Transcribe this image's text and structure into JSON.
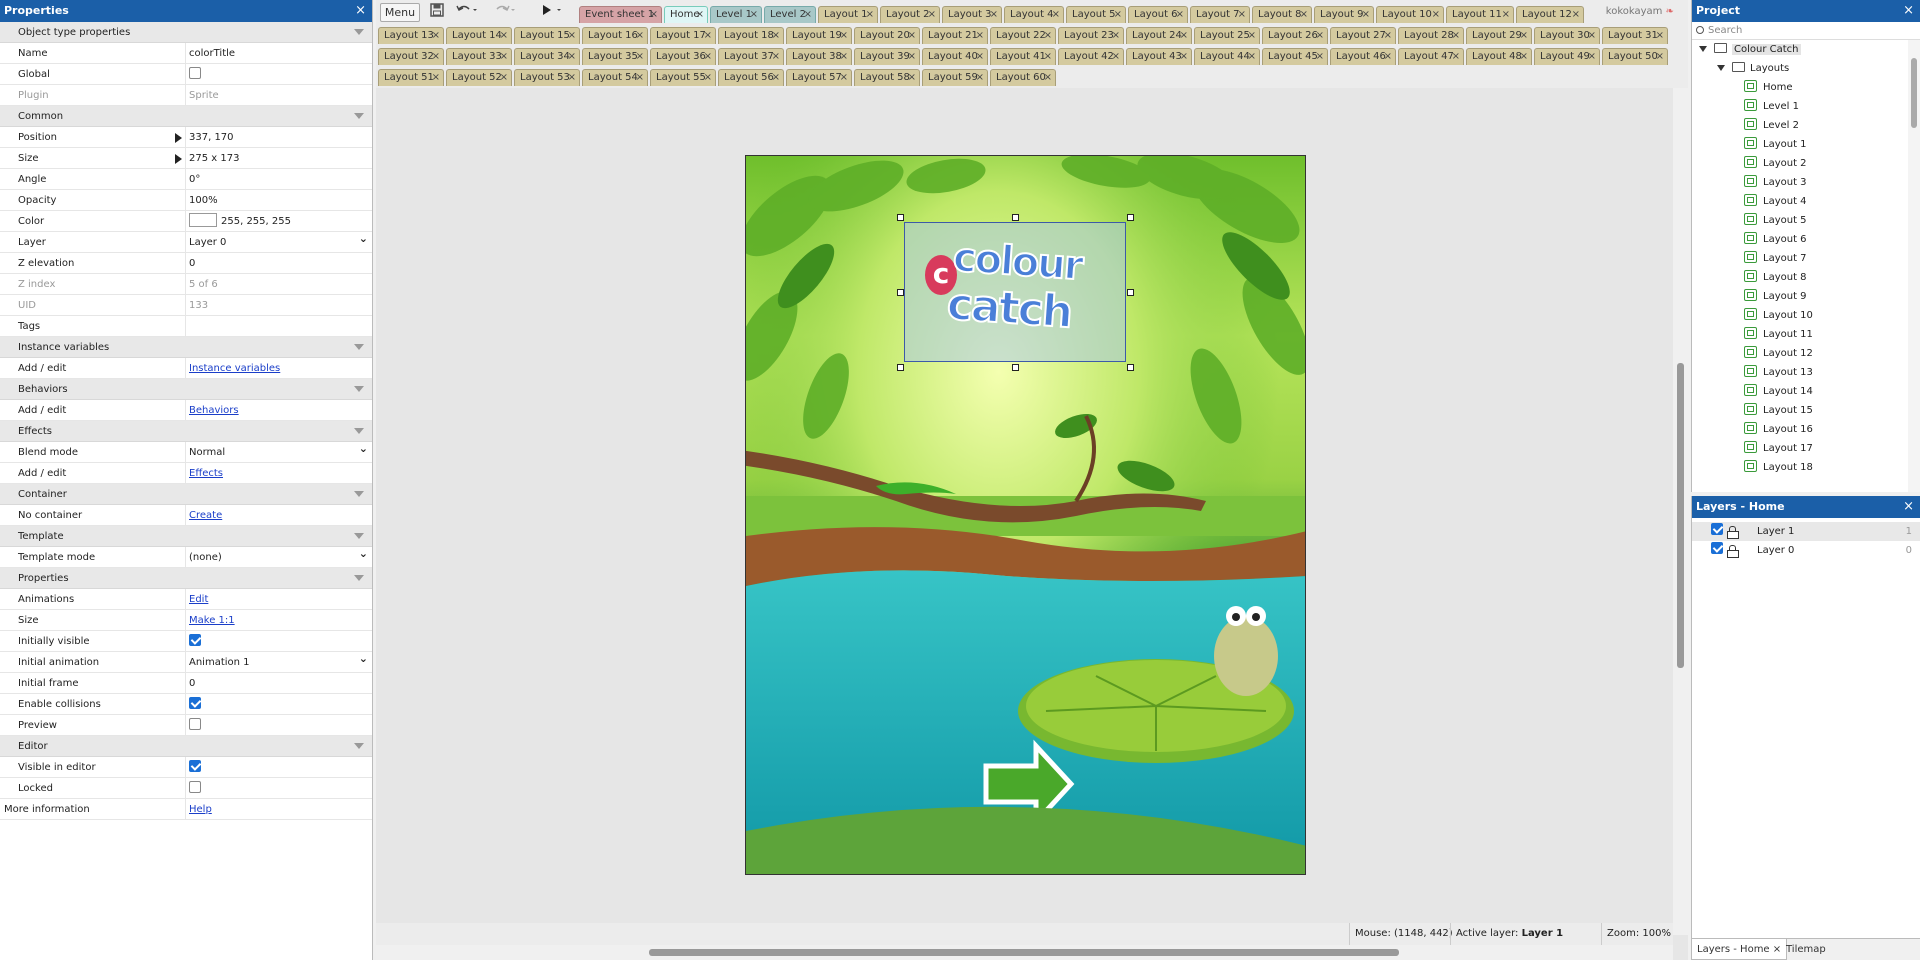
{
  "properties": {
    "title": "Properties",
    "close": "×",
    "rows": [
      {
        "type": "section",
        "name": "Object type properties"
      },
      {
        "type": "text",
        "name": "Name",
        "value": "colorTitle"
      },
      {
        "type": "check",
        "name": "Global",
        "checked": false
      },
      {
        "type": "text",
        "name": "Plugin",
        "value": "Sprite",
        "gray": true
      },
      {
        "type": "section",
        "name": "Common"
      },
      {
        "type": "text",
        "name": "Position",
        "value": "337, 170",
        "expand": true
      },
      {
        "type": "text",
        "name": "Size",
        "value": "275 x 173",
        "expand": true
      },
      {
        "type": "text",
        "name": "Angle",
        "value": "0°"
      },
      {
        "type": "text",
        "name": "Opacity",
        "value": "100%"
      },
      {
        "type": "color",
        "name": "Color",
        "value": "255, 255, 255"
      },
      {
        "type": "select",
        "name": "Layer",
        "value": "Layer 0"
      },
      {
        "type": "text",
        "name": "Z elevation",
        "value": "0"
      },
      {
        "type": "text",
        "name": "Z index",
        "value": "5 of 6",
        "gray": true
      },
      {
        "type": "text",
        "name": "UID",
        "value": "133",
        "gray": true
      },
      {
        "type": "text",
        "name": "Tags",
        "value": ""
      },
      {
        "type": "section",
        "name": "Instance variables"
      },
      {
        "type": "link",
        "name": "Add / edit",
        "value": "Instance variables"
      },
      {
        "type": "section",
        "name": "Behaviors"
      },
      {
        "type": "link",
        "name": "Add / edit",
        "value": "Behaviors"
      },
      {
        "type": "section",
        "name": "Effects"
      },
      {
        "type": "select",
        "name": "Blend mode",
        "value": "Normal"
      },
      {
        "type": "link",
        "name": "Add / edit",
        "value": "Effects"
      },
      {
        "type": "section",
        "name": "Container"
      },
      {
        "type": "link",
        "name": "No container",
        "value": "Create"
      },
      {
        "type": "section",
        "name": "Template"
      },
      {
        "type": "select",
        "name": "Template mode",
        "value": "(none)"
      },
      {
        "type": "section",
        "name": "Properties"
      },
      {
        "type": "link",
        "name": "Animations",
        "value": "Edit"
      },
      {
        "type": "link",
        "name": "Size",
        "value": "Make 1:1"
      },
      {
        "type": "check",
        "name": "Initially visible",
        "checked": true
      },
      {
        "type": "select",
        "name": "Initial animation",
        "value": "Animation 1"
      },
      {
        "type": "text",
        "name": "Initial frame",
        "value": "0"
      },
      {
        "type": "check",
        "name": "Enable collisions",
        "checked": true
      },
      {
        "type": "check",
        "name": "Preview",
        "checked": false
      },
      {
        "type": "section",
        "name": "Editor"
      },
      {
        "type": "check",
        "name": "Visible in editor",
        "checked": true
      },
      {
        "type": "check",
        "name": "Locked",
        "checked": false
      },
      {
        "type": "link",
        "name": "More information",
        "value": "Help",
        "noindent": true
      }
    ]
  },
  "toolbar": {
    "menu_label": "Menu",
    "user": "kokokayam"
  },
  "tabs_row1": [
    {
      "label": "Event sheet 1",
      "kind": "ev"
    },
    {
      "label": "Home",
      "kind": "act"
    },
    {
      "label": "Level 1",
      "kind": "lv"
    },
    {
      "label": "Level 2",
      "kind": "lv"
    },
    {
      "label": "Layout 1"
    },
    {
      "label": "Layout 2"
    },
    {
      "label": "Layout 3"
    },
    {
      "label": "Layout 4"
    },
    {
      "label": "Layout 5"
    },
    {
      "label": "Layout 6"
    },
    {
      "label": "Layout 7"
    },
    {
      "label": "Layout 8"
    },
    {
      "label": "Layout 9"
    },
    {
      "label": "Layout 10"
    },
    {
      "label": "Layout 11"
    },
    {
      "label": "Layout 12"
    }
  ],
  "tabs_row2": [
    "Layout 13",
    "Layout 14",
    "Layout 15",
    "Layout 16",
    "Layout 17",
    "Layout 18",
    "Layout 19",
    "Layout 20",
    "Layout 21",
    "Layout 22",
    "Layout 23",
    "Layout 24",
    "Layout 25",
    "Layout 26",
    "Layout 27",
    "Layout 28",
    "Layout 29",
    "Layout 30",
    "Layout 31"
  ],
  "tabs_row3": [
    "Layout 32",
    "Layout 33",
    "Layout 34",
    "Layout 35",
    "Layout 36",
    "Layout 37",
    "Layout 38",
    "Layout 39",
    "Layout 40",
    "Layout 41",
    "Layout 42",
    "Layout 43",
    "Layout 44",
    "Layout 45",
    "Layout 46",
    "Layout 47",
    "Layout 48",
    "Layout 49",
    "Layout 50"
  ],
  "tabs_row4": [
    "Layout 51",
    "Layout 52",
    "Layout 53",
    "Layout 54",
    "Layout 55",
    "Layout 56",
    "Layout 57",
    "Layout 58",
    "Layout 59",
    "Layout 60"
  ],
  "scene": {
    "logo_line1": "colour",
    "logo_line2": "catch",
    "logo_c": "c"
  },
  "status": {
    "mouse": "Mouse: (1148, 442)",
    "active_layer_label": "Active layer:",
    "active_layer": "Layer 1",
    "zoom": "Zoom: 100%"
  },
  "project": {
    "title": "Project",
    "close": "×",
    "search_placeholder": "Search",
    "root": "Colour Catch",
    "folder": "Layouts",
    "items": [
      "Home",
      "Level 1",
      "Level 2",
      "Layout 1",
      "Layout 2",
      "Layout 3",
      "Layout 4",
      "Layout 5",
      "Layout 6",
      "Layout 7",
      "Layout 8",
      "Layout 9",
      "Layout 10",
      "Layout 11",
      "Layout 12",
      "Layout 13",
      "Layout 14",
      "Layout 15",
      "Layout 16",
      "Layout 17",
      "Layout 18"
    ]
  },
  "layers": {
    "title": "Layers - Home",
    "close": "×",
    "items": [
      {
        "name": "Layer 1",
        "index": "1"
      },
      {
        "name": "Layer 0",
        "index": "0"
      }
    ]
  },
  "bottom_tabs": {
    "tab1": "Layers - Home",
    "tab1_close": "×",
    "tab2": "Tilemap"
  },
  "colors": {
    "panel_title": "#1b5fa8",
    "tab_layout": "#d4ca9f",
    "tab_event": "#d6a3a6",
    "tab_active": "#dff6f6",
    "link": "#1a3ec9"
  }
}
